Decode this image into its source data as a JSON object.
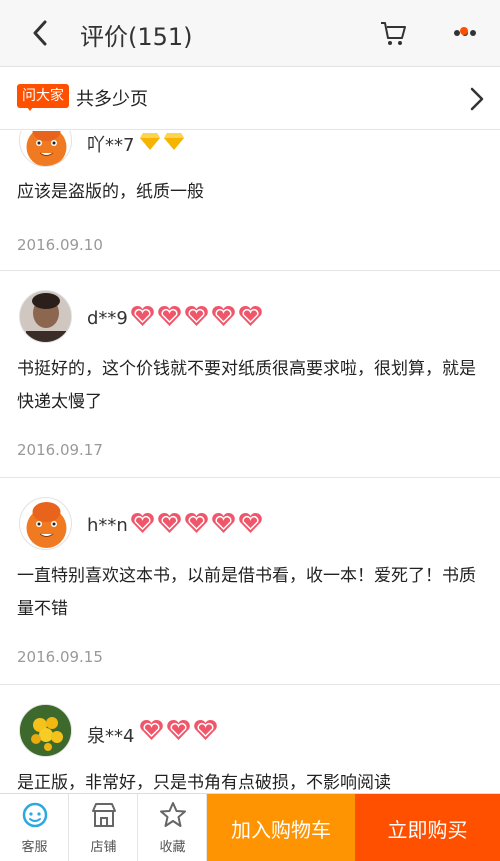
{
  "header": {
    "title": "评价(151)",
    "back_icon": "chevron-left-icon",
    "cart_icon": "cart-icon",
    "more_icon": "more-dots-icon"
  },
  "ask_bar": {
    "badge": "问大家",
    "question": "共多少页"
  },
  "reviews": [
    {
      "username": "吖**7",
      "badge_type": "diamond",
      "badge_count": 2,
      "content": "应该是盗版的，纸质一般",
      "date": "2016.09.10",
      "avatar": "cartoon-avatar"
    },
    {
      "username": "d**9",
      "badge_type": "heart",
      "badge_count": 5,
      "content": "书挺好的，这个价钱就不要对纸质很高要求啦，很划算，就是快递太慢了",
      "date": "2016.09.17",
      "avatar": "photo-avatar"
    },
    {
      "username": "h**n",
      "badge_type": "heart",
      "badge_count": 5,
      "content": "一直特别喜欢这本书，以前是借书看，收一本！爱死了！书质量不错",
      "date": "2016.09.15",
      "avatar": "cartoon-avatar"
    },
    {
      "username": "泉**4",
      "badge_type": "heart",
      "badge_count": 3,
      "content": "是正版，非常好，只是书角有点破损，不影响阅读",
      "date": "",
      "avatar": "flower-avatar"
    }
  ],
  "bottom_bar": {
    "service": "客服",
    "shop": "店铺",
    "favorite": "收藏",
    "add_to_cart": "加入购物车",
    "buy_now": "立即购买"
  },
  "colors": {
    "accent": "#ff5000",
    "cart_button": "#ff9402",
    "heart": "#f0566a",
    "diamond": "#f5b400"
  }
}
